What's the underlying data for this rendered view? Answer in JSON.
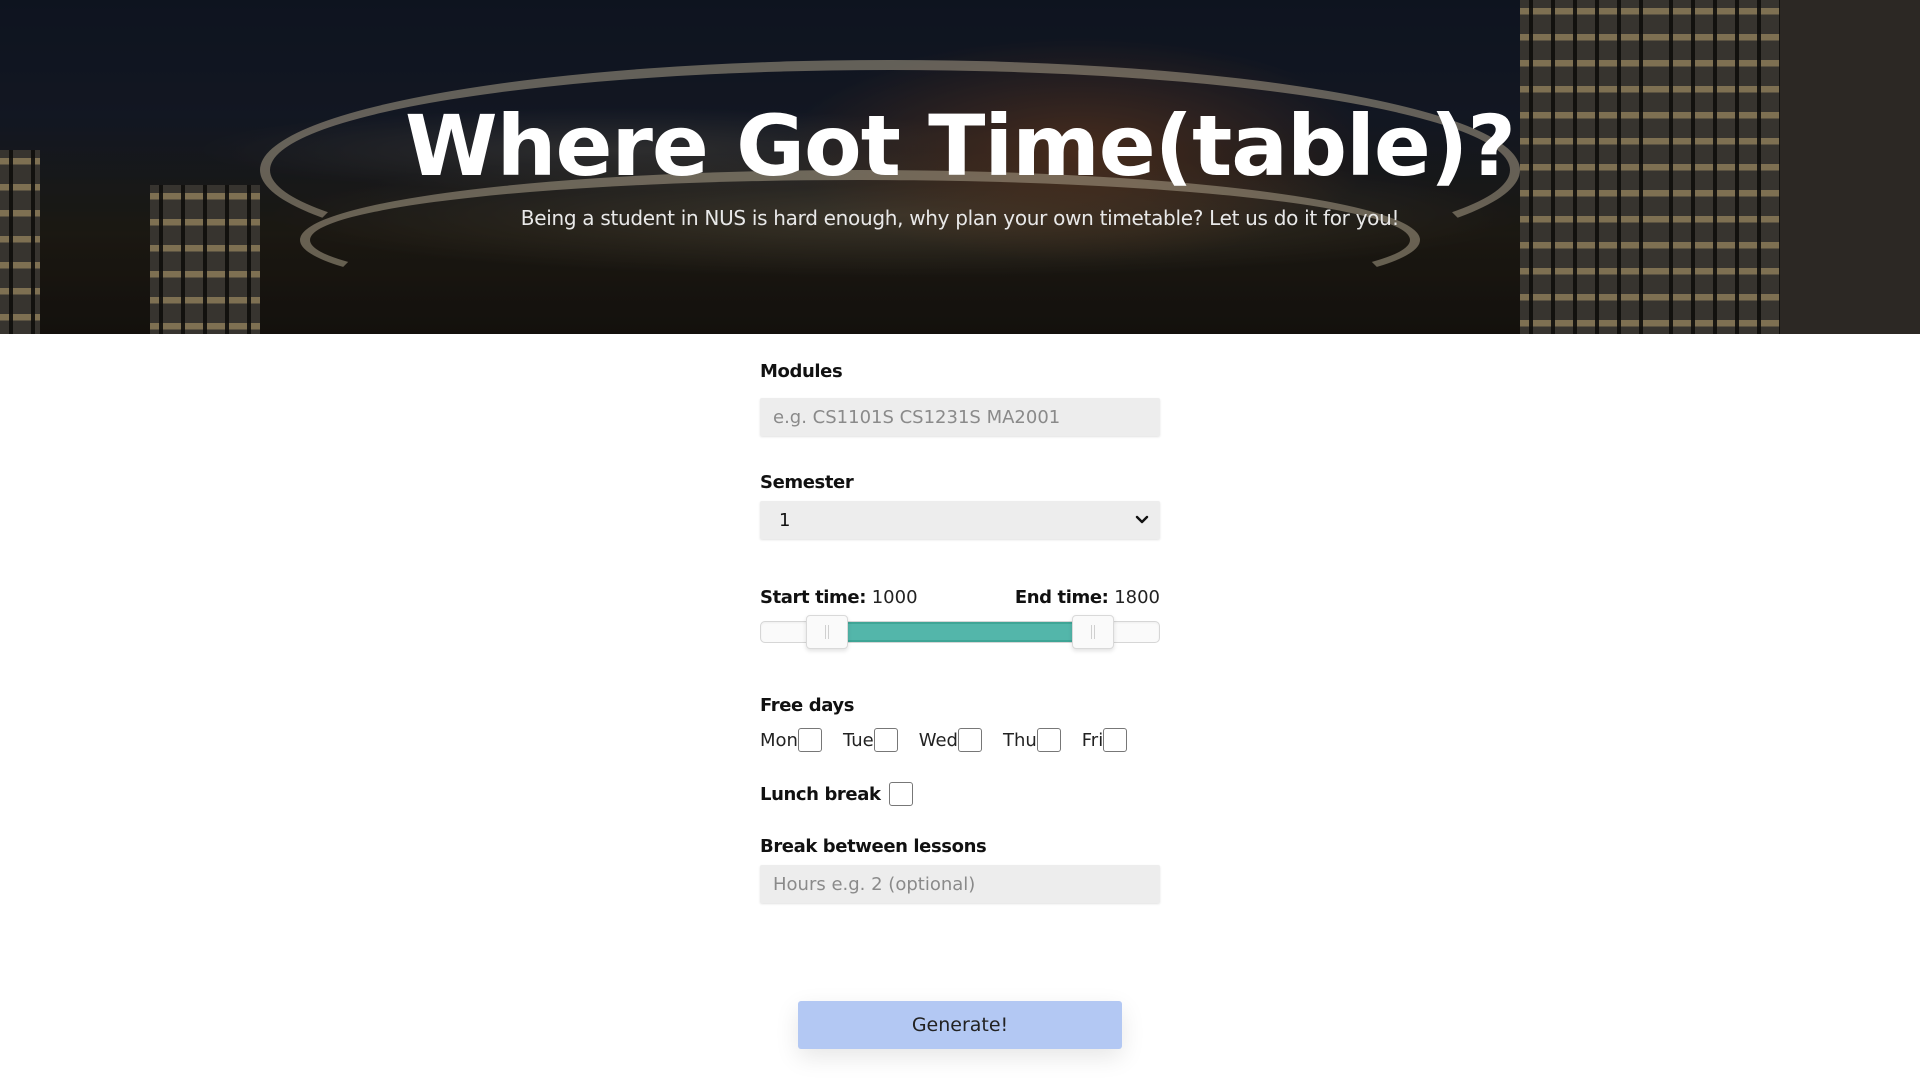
{
  "hero": {
    "title": "Where Got Time(table)?",
    "subtitle": "Being a student in NUS is hard enough, why plan your own timetable? Let us do it for you!"
  },
  "form": {
    "modules": {
      "label": "Modules",
      "value": "",
      "placeholder": "e.g. CS1101S CS1231S MA2001"
    },
    "semester": {
      "label": "Semester",
      "selected": "1",
      "icon": "chevron-down-icon"
    },
    "time": {
      "start_label": "Start time:",
      "start_value": "1000",
      "end_label": "End time:",
      "end_value": "1800",
      "range_min": 800,
      "range_max": 2000,
      "fill_color": "#53b6aa"
    },
    "free_days": {
      "label": "Free days",
      "days": [
        {
          "label": "Mon",
          "checked": false
        },
        {
          "label": "Tue",
          "checked": false
        },
        {
          "label": "Wed",
          "checked": false
        },
        {
          "label": "Thu",
          "checked": false
        },
        {
          "label": "Fri",
          "checked": false
        }
      ]
    },
    "lunch_break": {
      "label": "Lunch break",
      "checked": false
    },
    "break_between": {
      "label": "Break between lessons",
      "value": "",
      "placeholder": "Hours e.g. 2 (optional)"
    },
    "submit": {
      "label": "Generate!",
      "color": "#b3c8f3"
    }
  }
}
